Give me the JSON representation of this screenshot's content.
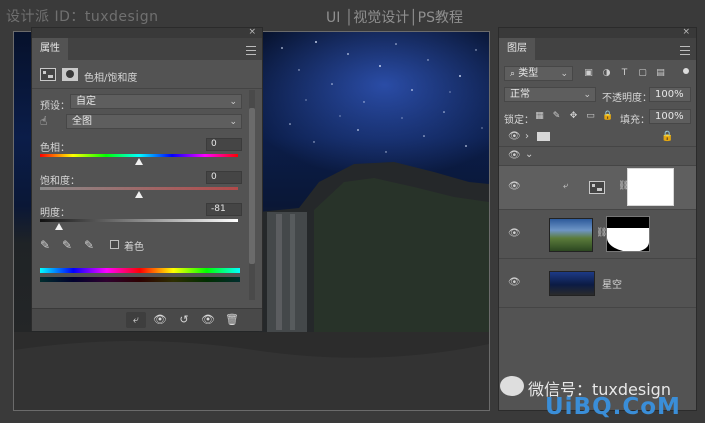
{
  "header": {
    "left_text": "设计派 ID：tuxdesign",
    "center_text": "UI │视觉设计│PS教程"
  },
  "properties": {
    "tab_label": "属性",
    "close_glyph": "×",
    "title": "色相/饱和度",
    "preset_label": "预设：",
    "preset_value": "自定",
    "channel_value": "全图",
    "hue_label": "色相：",
    "hue_value": "0",
    "saturation_label": "饱和度：",
    "saturation_value": "0",
    "lightness_label": "明度：",
    "lightness_value": "-81",
    "hue_level": 0.5,
    "saturation_level": 0.5,
    "lightness_level": 0.095,
    "colorize_label": "着色",
    "footer_glyphs": {
      "clip": "⤶",
      "visibility_preview": "👁",
      "reset": "↺",
      "visibility": "👁",
      "trash": "🗑"
    }
  },
  "layers": {
    "tab_label": "图层",
    "close_glyph": "×",
    "filter_label": "类型",
    "blend_mode": "正常",
    "opacity_label": "不透明度：",
    "opacity_value": "100%",
    "lock_label": "锁定：",
    "fill_label": "填充：",
    "fill_value": "100%",
    "rows": [
      {
        "name": ""
      },
      {
        "name": ""
      },
      {
        "name": ""
      },
      {
        "name": ""
      },
      {
        "name": "星空"
      }
    ]
  },
  "watermark": {
    "wechat": "微信号：tuxdesign",
    "site": "UiBQ.CoM"
  },
  "colors": {
    "panel_bg": "#535353",
    "accent_blue": "#3a8ed8"
  }
}
